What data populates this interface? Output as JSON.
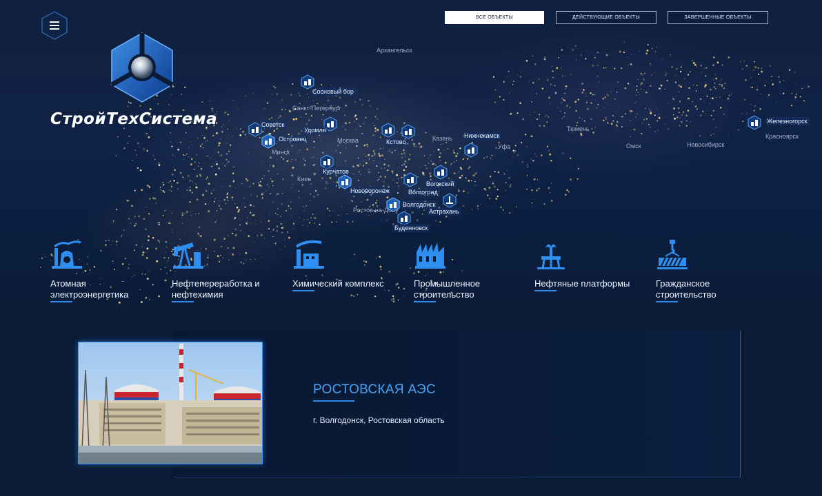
{
  "header": {
    "brand_name": "СтройТехСистема",
    "menu_icon": "hamburger-icon",
    "filters": [
      {
        "label": "ВСЕ ОБЪЕКТЫ",
        "active": true
      },
      {
        "label": "ДЕЙСТВУЮЩИЕ ОБЪЕКТЫ",
        "active": false
      },
      {
        "label": "ЗАВЕРШЕННЫЕ ОБЪЕКТЫ",
        "active": false
      }
    ]
  },
  "map": {
    "city_labels": {
      "arkhangelsk": "Архангельск",
      "spb": "Санкт-Петербург",
      "moscow": "Москва",
      "minsk": "Минск",
      "kiev": "Киев",
      "kazan": "Казань",
      "ufa": "Уфа",
      "tyumen": "Тюмень",
      "omsk": "Омск",
      "novosibirsk": "Новосибирск",
      "krasnoyarsk": "Красноярск",
      "rostov": "Ростов-на-Дону"
    },
    "markers": {
      "sosnovy_bor": "Сосновый бор",
      "sovetsk": "Советск",
      "ostrovets": "Островец",
      "udomlya": "Удомля",
      "kstovo": "Кстово",
      "nizhnekamsk": "Нижнекамск",
      "kurchatov": "Курчатов",
      "novovoronezh": "Нововоронеж",
      "volzhsky": "Волжский",
      "volgograd": "Волгоград",
      "volgodonsk": "Волгодонск",
      "astrakhan": "Астрахань",
      "budennovsk": "Буденновск",
      "zheleznogorsk": "Железногорск"
    }
  },
  "categories": [
    {
      "label_line1": "Атомная",
      "label_line2": "электроэнергетика",
      "icon": "nuclear-plant-icon"
    },
    {
      "label_line1": "Нефтепереработка и",
      "label_line2": "нефтехимия",
      "icon": "oil-pump-icon"
    },
    {
      "label_line1": "Химический комплекс",
      "label_line2": "",
      "icon": "chemical-plant-icon"
    },
    {
      "label_line1": "Промышленное",
      "label_line2": "строительство",
      "icon": "factory-icon"
    },
    {
      "label_line1": "Нефтяные платформы",
      "label_line2": "",
      "icon": "oil-platform-icon"
    },
    {
      "label_line1": "Гражданское",
      "label_line2": "строительство",
      "icon": "crane-icon"
    }
  ],
  "project": {
    "title": "РОСТОВСКАЯ АЭС",
    "location": "г. Волгодонск, Ростовская область"
  },
  "colors": {
    "accent": "#2e8ff0",
    "title_blue": "#4aa3f5",
    "background": "#0a1b36"
  }
}
